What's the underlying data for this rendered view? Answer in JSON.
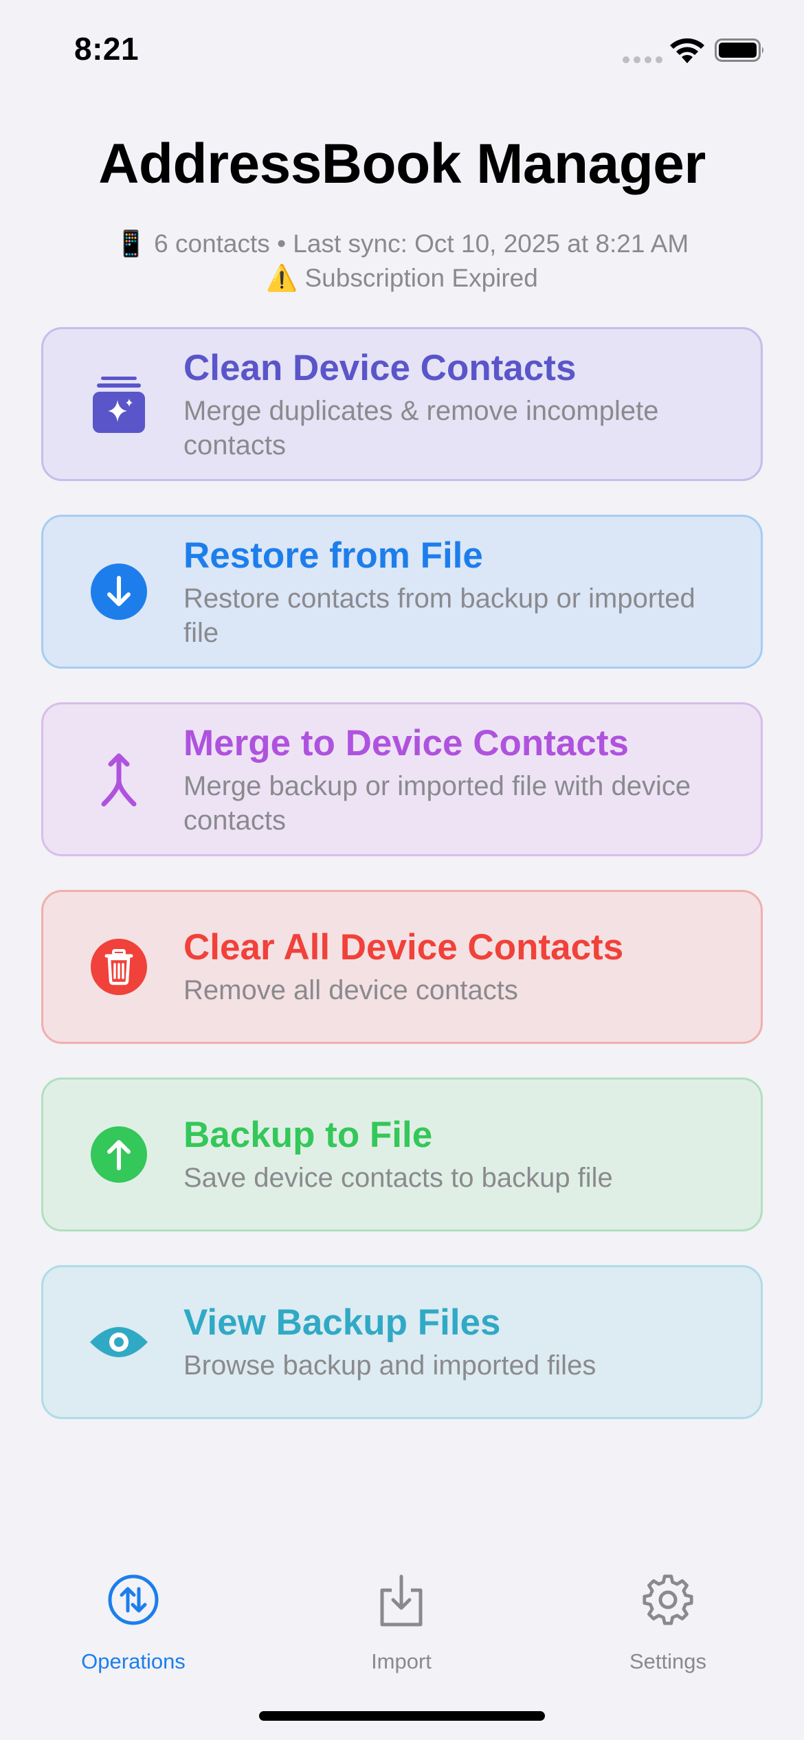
{
  "status_bar": {
    "time": "8:21"
  },
  "header": {
    "title": "AddressBook Manager",
    "sync_icon": "📱",
    "sync_text": "6 contacts • Last sync: Oct 10, 2025 at 8:21 AM",
    "warning_icon": "⚠️",
    "subscription_text": "Subscription Expired"
  },
  "cards": [
    {
      "title": "Clean Device Contacts",
      "description": "Merge duplicates & remove incomplete contacts",
      "icon": "sparkle-tray-icon",
      "color": "#5A55C9"
    },
    {
      "title": "Restore from File",
      "description": "Restore contacts from backup or imported file",
      "icon": "arrow-down-circle-icon",
      "color": "#1D7EEB"
    },
    {
      "title": "Merge to Device Contacts",
      "description": "Merge backup or imported file with device contacts",
      "icon": "merge-arrow-icon",
      "color": "#AF52DE"
    },
    {
      "title": "Clear All Device Contacts",
      "description": "Remove all device contacts",
      "icon": "trash-circle-icon",
      "color": "#F0413A"
    },
    {
      "title": "Backup to File",
      "description": "Save device contacts to backup file",
      "icon": "arrow-up-circle-icon",
      "color": "#34C759"
    },
    {
      "title": "View Backup Files",
      "description": "Browse backup and imported files",
      "icon": "eye-icon",
      "color": "#30A9C5"
    }
  ],
  "tab_bar": {
    "tabs": [
      {
        "label": "Operations",
        "icon": "arrows-up-down-circle-icon",
        "active": true
      },
      {
        "label": "Import",
        "icon": "tray-download-icon",
        "active": false
      },
      {
        "label": "Settings",
        "icon": "gear-icon",
        "active": false
      }
    ]
  }
}
